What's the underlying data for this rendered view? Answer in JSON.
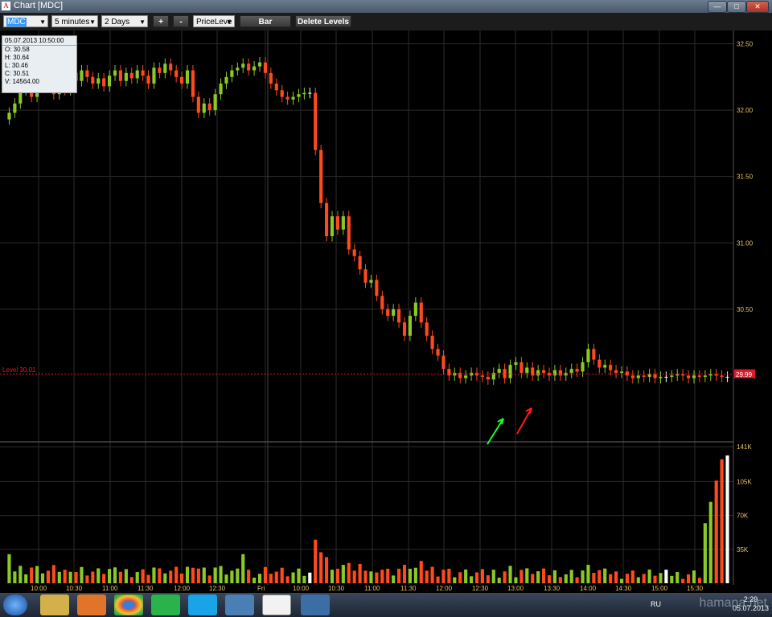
{
  "window": {
    "title": "Chart [MDC]",
    "app_icon": "A"
  },
  "toolbar": {
    "symbol": "MDC",
    "interval": "5 minutes",
    "range": "2 Days",
    "zoom_in": "+",
    "zoom_out": "-",
    "mode": "PriceLeve",
    "chart_type": "Bar",
    "delete_levels": "Delete Levels"
  },
  "infobox": {
    "datetime": "05.07.2013 10:50:00",
    "open": "O: 30.58",
    "high": "H: 30.64",
    "low": "L: 30.46",
    "close": "C: 30.51",
    "volume": "V: 14564.00"
  },
  "level": {
    "label": "Level 30.01",
    "price_tag": "29.99",
    "value": 30.01
  },
  "colors": {
    "up": "#8ac926",
    "down": "#ff4a1c",
    "neutral": "#ffffff",
    "level": "#e0192d",
    "grid": "#2b2b2b",
    "axis_text": "#e8c26b"
  },
  "chart_data": {
    "type": "candlestick",
    "price_axis": {
      "ticks": [
        "32.50",
        "32.00",
        "31.50",
        "31.00",
        "30.50"
      ],
      "values": [
        32.5,
        32.0,
        31.5,
        31.0,
        30.5
      ],
      "range": [
        29.5,
        32.6
      ]
    },
    "volume_axis": {
      "ticks": [
        "141K",
        "105K",
        "70K",
        "35K"
      ],
      "values": [
        141,
        105,
        70,
        35
      ],
      "range": [
        0,
        141
      ]
    },
    "time_ticks": [
      "10:00",
      "10:30",
      "11:00",
      "11:30",
      "12:00",
      "12:30",
      "Fri",
      "10:00",
      "10:30",
      "11:00",
      "11:30",
      "12:00",
      "12:30",
      "13:00",
      "13:30",
      "14:00",
      "14:30",
      "15:00",
      "15:30"
    ],
    "annotations": [
      {
        "type": "arrow",
        "color": "green"
      },
      {
        "type": "arrow",
        "color": "red"
      }
    ]
  },
  "taskbar": {
    "icons": [
      "start-orb",
      "explorer-icon",
      "media-player-icon",
      "chrome-icon",
      "mail-icon",
      "skype-icon",
      "desktop-icon",
      "app-a-icon",
      "window-icon"
    ],
    "language": "RU",
    "time": "2:29",
    "date": "05.07.2013"
  },
  "watermark": "hamana.net"
}
